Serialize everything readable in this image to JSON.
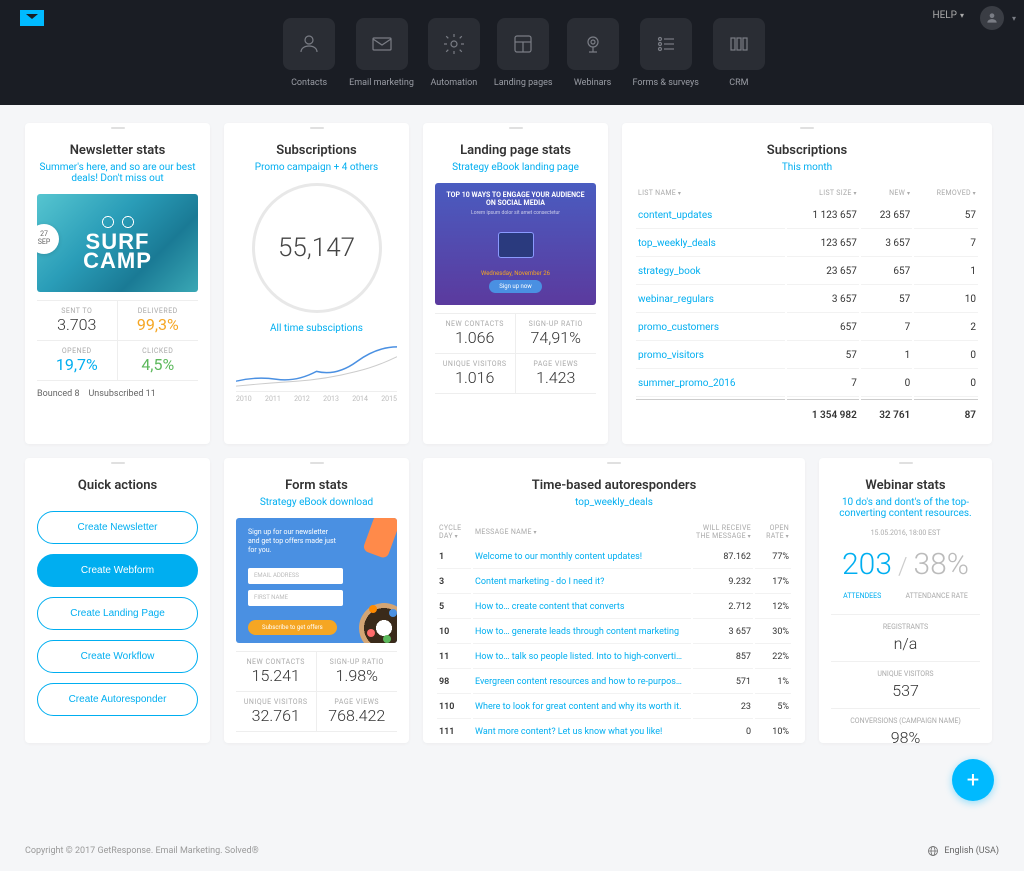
{
  "nav": {
    "items": [
      {
        "label": "Contacts"
      },
      {
        "label": "Email marketing"
      },
      {
        "label": "Automation"
      },
      {
        "label": "Landing pages"
      },
      {
        "label": "Webinars"
      },
      {
        "label": "Forms & surveys"
      },
      {
        "label": "CRM"
      }
    ],
    "help": "HELP"
  },
  "newsletter": {
    "title": "Newsletter stats",
    "subtitle": "Summer's here, and so are our best deals! Don't miss out",
    "date_day": "27",
    "date_mon": "SEP",
    "surf_line1": "SURF",
    "surf_line2": "CAMP",
    "sent_label": "SENT TO",
    "sent_value": "3.703",
    "delivered_label": "DELIVERED",
    "delivered_value": "99,3%",
    "opened_label": "OPENED",
    "opened_value": "19,7%",
    "clicked_label": "CLICKED",
    "clicked_value": "4,5%",
    "bounced": "Bounced  8",
    "unsub": "Unsubscribed  11"
  },
  "subs_circle": {
    "title": "Subscriptions",
    "subtitle": "Promo campaign + 4 others",
    "value": "55,147",
    "all_time": "All time subsciptions",
    "years": [
      "2010",
      "2011",
      "2012",
      "2013",
      "2014",
      "2015"
    ]
  },
  "landing": {
    "title": "Landing page stats",
    "subtitle": "Strategy eBook landing page",
    "img_head": "TOP 10 WAYS TO ENGAGE YOUR AUDIENCE ON SOCIAL MEDIA",
    "img_sub": "Lorem ipsum dolor sit amet consectetur",
    "img_date": "Wednesday, November 26",
    "img_btn": "Sign up now",
    "new_contacts_label": "NEW CONTACTS",
    "new_contacts": "1.066",
    "signup_label": "SIGN-UP RATIO",
    "signup": "74,91%",
    "unique_label": "UNIQUE VISITORS",
    "unique": "1.016",
    "views_label": "PAGE VIEWS",
    "views": "1.423"
  },
  "subs_table": {
    "title": "Subscriptions",
    "subtitle": "This month",
    "headers": [
      "LIST NAME",
      "LIST SIZE",
      "NEW",
      "REMOVED"
    ],
    "rows": [
      {
        "name": "content_updates",
        "size": "1 123 657",
        "new": "23 657",
        "removed": "57"
      },
      {
        "name": "top_weekly_deals",
        "size": "123 657",
        "new": "3 657",
        "removed": "7"
      },
      {
        "name": "strategy_book",
        "size": "23 657",
        "new": "657",
        "removed": "1"
      },
      {
        "name": "webinar_regulars",
        "size": "3 657",
        "new": "57",
        "removed": "10"
      },
      {
        "name": "promo_customers",
        "size": "657",
        "new": "7",
        "removed": "2"
      },
      {
        "name": "promo_visitors",
        "size": "57",
        "new": "1",
        "removed": "0"
      },
      {
        "name": "summer_promo_2016",
        "size": "7",
        "new": "0",
        "removed": "0"
      }
    ],
    "totals": {
      "size": "1 354 982",
      "new": "32 761",
      "removed": "87"
    }
  },
  "quick": {
    "title": "Quick actions",
    "actions": [
      "Create Newsletter",
      "Create Webform",
      "Create Landing Page",
      "Create Workflow",
      "Create Autoresponder"
    ]
  },
  "form_stats": {
    "title": "Form stats",
    "subtitle": "Strategy eBook download",
    "img_txt": "Sign up for our newsletter and get top offers made just for you.",
    "field1": "EMAIL ADDRESS",
    "field2": "FIRST NAME",
    "submit": "Subscribe to get offers",
    "nc_label": "NEW CONTACTS",
    "nc": "15.241",
    "su_label": "SIGN-UP RATIO",
    "su": "1.98%",
    "uv_label": "UNIQUE VISITORS",
    "uv": "32.761",
    "pv_label": "PAGE VIEWS",
    "pv": "768.422"
  },
  "autoresponders": {
    "title": "Time-based autoresponders",
    "subtitle": "top_weekly_deals",
    "headers": [
      "CYCLE DAY",
      "MESSAGE NAME",
      "WILL RECEIVE THE MESSAGE",
      "OPEN RATE"
    ],
    "rows": [
      {
        "day": "1",
        "msg": "Welcome to our monthly content updates!",
        "recv": "87.162",
        "rate": "77%"
      },
      {
        "day": "3",
        "msg": "Content marketing - do I need it?",
        "recv": "9.232",
        "rate": "17%"
      },
      {
        "day": "5",
        "msg": "How to… create content that converts",
        "recv": "2.712",
        "rate": "12%"
      },
      {
        "day": "10",
        "msg": "How to… generate leads through content marketing",
        "recv": "3 657",
        "rate": "30%"
      },
      {
        "day": "11",
        "msg": "How to… talk so people listed. Into to high-converti…",
        "recv": "857",
        "rate": "22%"
      },
      {
        "day": "98",
        "msg": "Evergreen content resources and how to re-purpos…",
        "recv": "571",
        "rate": "1%"
      },
      {
        "day": "110",
        "msg": "Where to look for great content and why its worth it.",
        "recv": "23",
        "rate": "5%"
      },
      {
        "day": "111",
        "msg": "Want more content? Let us know what you like!",
        "recv": "0",
        "rate": "10%"
      }
    ]
  },
  "webinar": {
    "title": "Webinar stats",
    "subtitle": "10 do's and dont's of the top-converting content resources.",
    "date": "15.05.2016, 18:00 EST",
    "attendees": "203",
    "attendees_label": "ATTENDEES",
    "rate": "38%",
    "rate_label": "ATTENDANCE RATE",
    "reg_label": "REGISTRANTS",
    "reg": "n/a",
    "uv_label": "UNIQUE VISITORS",
    "uv": "537",
    "conv_label": "CONVERSIONS (CAMPAIGN NAME)",
    "conv": "98%"
  },
  "footer": {
    "copy": "Copyright © 2017 GetResponse. Email Marketing. Solved®",
    "lang": "English (USA)"
  }
}
